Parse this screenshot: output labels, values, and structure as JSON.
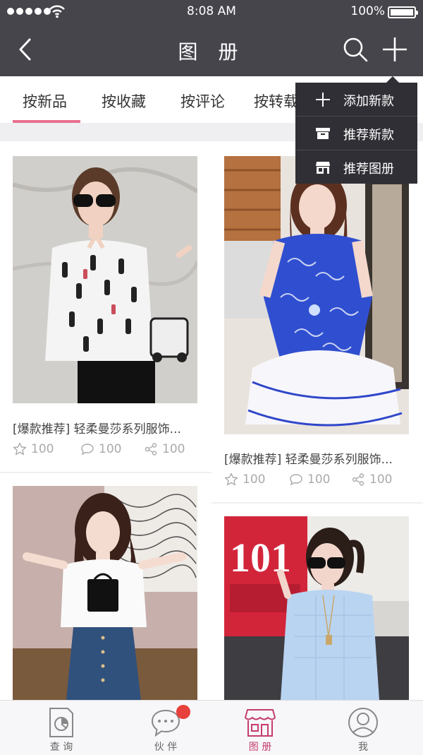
{
  "status_bar": {
    "time": "8:08 AM",
    "battery": "100%"
  },
  "nav": {
    "title": "图 册",
    "icons": [
      "chevron-left-icon",
      "search-icon",
      "plus-icon"
    ]
  },
  "tabs": [
    {
      "label": "按新品",
      "active": true
    },
    {
      "label": "按收藏",
      "active": false
    },
    {
      "label": "按评论",
      "active": false
    },
    {
      "label": "按转载",
      "active": false
    }
  ],
  "dropdown": {
    "items": [
      {
        "label": "添加新款",
        "icon": "plus-icon"
      },
      {
        "label": "推荐新款",
        "icon": "archive-box-icon"
      },
      {
        "label": "推荐图册",
        "icon": "storefront-icon"
      }
    ]
  },
  "products": [
    {
      "title": "[爆款推荐] 轻柔曼莎系列服饰...",
      "favorites": "100",
      "comments": "100",
      "shares": "100"
    },
    {
      "title": "[爆款推荐] 轻柔曼莎系列服饰...",
      "favorites": "100",
      "comments": "100",
      "shares": "100"
    },
    {
      "photo_text": "101"
    }
  ],
  "bottom_nav": [
    {
      "label": "查 询",
      "icon": "document-chart-icon",
      "active": false
    },
    {
      "label": "伙 伴",
      "icon": "chat-bubble-icon",
      "active": false,
      "badge": true
    },
    {
      "label": "图 册",
      "icon": "storefront-icon",
      "active": true
    },
    {
      "label": "我",
      "icon": "user-icon",
      "active": false
    }
  ],
  "colors": {
    "header_bg": "#46454c",
    "accent_pink": "#e8718f",
    "active_tab_icon": "#c53d6b",
    "dropdown_bg": "#2f2f35",
    "badge_red": "#e8403c"
  }
}
